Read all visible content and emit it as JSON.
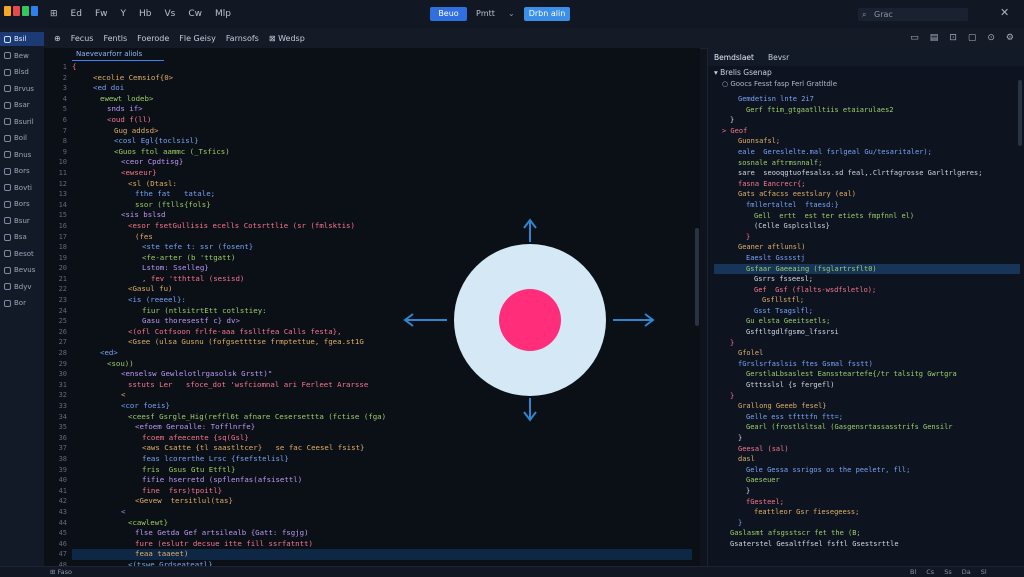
{
  "menubar": {
    "items": [
      "⊞",
      "Ed",
      "Fw",
      "Y",
      "Hb",
      "Vs",
      "Cw",
      "Mlp"
    ],
    "run_label": "Beuo",
    "run_target": "Pmtt",
    "run_caret": "⌄",
    "debug_label": "Drbn alin",
    "search_icon": "⌕",
    "search_text": "Grac",
    "close_glyph": "✕"
  },
  "logo_colors": [
    "#f5a623",
    "#e5484d",
    "#34c759",
    "#2f80ed"
  ],
  "sidebar": {
    "items": [
      {
        "label": "Bsil",
        "active": true
      },
      {
        "label": "Bew"
      },
      {
        "label": "Blsd"
      },
      {
        "label": "Brvus"
      },
      {
        "label": "Bsar"
      },
      {
        "label": "Bsuril"
      },
      {
        "label": "Boil"
      },
      {
        "label": "Bnus"
      },
      {
        "label": "Bors"
      },
      {
        "label": "Bovti"
      },
      {
        "label": "Bors"
      },
      {
        "label": "Bsur"
      },
      {
        "label": "Bsa"
      },
      {
        "label": "Besot"
      },
      {
        "label": "Bevus"
      },
      {
        "label": "Bdyv"
      },
      {
        "label": "Bor"
      }
    ]
  },
  "toolbar": {
    "items": [
      "⊕",
      "Fecus",
      "Fentls",
      "Foerode",
      "Fle Geisy",
      "Farnsofs",
      "⊠ Wedsp"
    ],
    "right_icons": [
      "▭",
      "▤",
      "⊡",
      "▢",
      "⊙",
      "⚙"
    ]
  },
  "editor": {
    "tab_label": "Naevevarforr aliols",
    "line_numbers": [
      "1",
      "2",
      "3",
      "4",
      "5",
      "6",
      "7",
      "8",
      "9",
      "10",
      "11",
      "12",
      "13",
      "14",
      "15",
      "16",
      "17",
      "18",
      "19",
      "20",
      "21",
      "22",
      "23",
      "24",
      "25",
      "26",
      "27",
      "28",
      "29",
      "30",
      "31",
      "32",
      "33",
      "34",
      "35",
      "36",
      "37",
      "38",
      "39",
      "40",
      "41",
      "42",
      "43",
      "44",
      "45",
      "46",
      "47",
      "48"
    ],
    "lines": [
      {
        "indent": 0,
        "text": "{"
      },
      {
        "indent": 3,
        "text": "<ecolie Cemsiof{0>"
      },
      {
        "indent": 3,
        "text": "<ed doi"
      },
      {
        "indent": 4,
        "text": "ewewt lodeb>"
      },
      {
        "indent": 5,
        "text": "snds if>"
      },
      {
        "indent": 5,
        "text": "<oud f(ll)"
      },
      {
        "indent": 6,
        "text": "Gug addsd>"
      },
      {
        "indent": 6,
        "text": "<cosl Egl{toclsisl}"
      },
      {
        "indent": 6,
        "text": "<Guos ftol aammc (_Tsfics)"
      },
      {
        "indent": 7,
        "text": "<ceor Cpdtisg}"
      },
      {
        "indent": 7,
        "text": "<ewseur}"
      },
      {
        "indent": 8,
        "text": "<sl (Dtasl:"
      },
      {
        "indent": 9,
        "text": "fthe fat   tatale;"
      },
      {
        "indent": 9,
        "text": "ssor (ftlls{fols}"
      },
      {
        "indent": 7,
        "text": "<sis bslsd"
      },
      {
        "indent": 8,
        "text": "<esor fsetGullisis ecells Cotsrttlie (sr (fmlsktis)"
      },
      {
        "indent": 9,
        "text": "(fes"
      },
      {
        "indent": 10,
        "text": "<ste tefe t: ssr (fosent}"
      },
      {
        "indent": 10,
        "text": "<fe-arter (b 'ttgatt)"
      },
      {
        "indent": 10,
        "text": "Lstom: Sselleg}"
      },
      {
        "indent": 10,
        "text": ", fev 'tthttal (sesisd)"
      },
      {
        "indent": 8,
        "text": "<Gasul fu)"
      },
      {
        "indent": 8,
        "text": "<is (reeeel}:"
      },
      {
        "indent": 10,
        "text": "fiur (ntlsitrtEtt cotlstiey:"
      },
      {
        "indent": 10,
        "text": "Gasu thoresestf c} dv>"
      },
      {
        "indent": 8,
        "text": "<(ofl Cotfsoon frlfe-aaa fsslltfea Calls festa},"
      },
      {
        "indent": 8,
        "text": "<Gsee (ulsa Gusnu (fofgsettttse frmptettue, fgea.st1G"
      },
      {
        "indent": 4,
        "text": "<ed>"
      },
      {
        "indent": 5,
        "text": "<sou))"
      },
      {
        "indent": 7,
        "text": "<enselsw Gewlelotlrgasolsk Grstt)\""
      },
      {
        "indent": 8,
        "text": "sstuts Ler   sfoce_dot 'wsfciomnal ari Ferleet Ararsse"
      },
      {
        "indent": 7,
        "text": "<"
      },
      {
        "indent": 7,
        "text": "<cor foeis}"
      },
      {
        "indent": 8,
        "text": "<ceesf Gsrgle_Hig(reffl6t afnare Cesersettta (fctise (fga)"
      },
      {
        "indent": 9,
        "text": "<efoem Geroalle: Tofflnrfe}"
      },
      {
        "indent": 10,
        "text": "fcoem afeecente {sq(Gsl}"
      },
      {
        "indent": 10,
        "text": "<aws Csatte {tl saastltcer}   se fac Ceesel fsist}"
      },
      {
        "indent": 10,
        "text": "feas lcorerthe Lrsc {fsefstelisl}"
      },
      {
        "indent": 10,
        "text": "fris  Gsus Gtu Etftl}"
      },
      {
        "indent": 10,
        "text": "fifie hserretd (spflenfas(afsisettl)"
      },
      {
        "indent": 10,
        "text": "fine  fsrs)tpoitl}"
      },
      {
        "indent": 9,
        "text": "<Gevew  tersitlul(tas}"
      },
      {
        "indent": 7,
        "text": "<"
      },
      {
        "indent": 8,
        "text": "<cawlewt}"
      },
      {
        "indent": 9,
        "text": "flse Getda Gef artsilealb {Gatt: fsgjg)"
      },
      {
        "indent": 9,
        "text": "fure (eslutr decsue itte fill ssrfatntt)"
      },
      {
        "indent": 9,
        "text": "feaa taaeet)"
      },
      {
        "indent": 8,
        "text": "<(tswe Grdseateatl}"
      }
    ],
    "highlight_line": 46
  },
  "rpanel": {
    "tabs": [
      "Bemdslaet",
      "Bevsr"
    ],
    "header": "▾  Brelis Gsenap",
    "subheader": "○  Goocs  Fesst  fasp Ferl Gratltdle",
    "lines": [
      {
        "indent": 3,
        "text": "Gemdetisn lnte 2i7"
      },
      {
        "indent": 4,
        "text": "Gerf ftim_gtgaatlltiis etaiarulaes2"
      },
      {
        "indent": 2,
        "text": "}"
      },
      {
        "indent": 1,
        "text": "> Geof"
      },
      {
        "indent": 3,
        "text": "Guonsafsl;"
      },
      {
        "indent": 3,
        "text": "eale  Gereslelte.mal fsrlgeal Gu/tesaritaler);"
      },
      {
        "indent": 3,
        "text": "sosnale aftrmsnnalf;"
      },
      {
        "indent": 3,
        "text": "sare  seooqgtuofesalss.sd feal,.Clrtfagrosse Garltrlgeres;"
      },
      {
        "indent": 3,
        "text": "fasna Eancrecr{;"
      },
      {
        "indent": 3,
        "text": "Gats aCfacss eestslary (eal)"
      },
      {
        "indent": 4,
        "text": "fmllertaltel  ftaesd:}"
      },
      {
        "indent": 5,
        "text": "Gell  ertt  est ter etiets fmpfnnl el)"
      },
      {
        "indent": 5,
        "text": "(Celle Gsplcsllss}"
      },
      {
        "indent": 4,
        "text": "}"
      },
      {
        "indent": 3,
        "text": "Geaner aftlunsl)"
      },
      {
        "indent": 4,
        "text": "Eaeslt Gsssstj"
      },
      {
        "indent": 4,
        "text": "Gsfaar Gaeeaing (fsglartrsflt0)"
      },
      {
        "indent": 5,
        "text": "Gsrrs fsseesl;"
      },
      {
        "indent": 5,
        "text": "Gef  Gsf (flalts-wsdfsletlo);"
      },
      {
        "indent": 6,
        "text": "Gsfllstfl;"
      },
      {
        "indent": 5,
        "text": "Gsst Tsagslfl;"
      },
      {
        "indent": 4,
        "text": "Gu elsta Geeitsetls;"
      },
      {
        "indent": 4,
        "text": "Gsftltgdlfgsmo_lfssrsi"
      },
      {
        "indent": 2,
        "text": "}"
      },
      {
        "indent": 3,
        "text": "Gfolel"
      },
      {
        "indent": 3,
        "text": "fGrslsrfaslsis ftes Gsmal fsstt)"
      },
      {
        "indent": 4,
        "text": "GerstlaLbsaslest Eanssteartefe{/tr talsitg Gwrtgra"
      },
      {
        "indent": 4,
        "text": "Gtttsslsl {s fergefl)"
      },
      {
        "indent": 2,
        "text": "}"
      },
      {
        "indent": 3,
        "text": "Grallong Geeeb fesel}"
      },
      {
        "indent": 4,
        "text": "Gelle ess tftttfn ftt=;"
      },
      {
        "indent": 4,
        "text": "Gearl (frostlsltsal (Gasgensrtassasstrifs Gensilr"
      },
      {
        "indent": 3,
        "text": "}"
      },
      {
        "indent": 3,
        "text": "Geesal (sal)"
      },
      {
        "indent": 3,
        "text": "dasl"
      },
      {
        "indent": 4,
        "text": "Gele Gessa ssrigos os the peeletr, fll;"
      },
      {
        "indent": 4,
        "text": "Gaeseuer"
      },
      {
        "indent": 4,
        "text": "}"
      },
      {
        "indent": 4,
        "text": "fGesteel;"
      },
      {
        "indent": 5,
        "text": "feattleor Gsr fiesegeess;"
      },
      {
        "indent": 3,
        "text": "}"
      },
      {
        "indent": 2,
        "text": "Gaslasmt afsgsstscr fet the (B;"
      },
      {
        "indent": 2,
        "text": "Gsaterstel Gesaltffsel fsftl Gsestsrttle"
      }
    ],
    "highlight_line": 16
  },
  "statusbar": {
    "left": "⊞  Faso",
    "right": [
      "Bl",
      "Cs",
      "Ss",
      "Da",
      "Sl"
    ]
  },
  "overlay": {
    "circle_color": "#d4e8f6",
    "dot_color": "#ff2d7a",
    "arrow_color": "#2e86d1"
  }
}
